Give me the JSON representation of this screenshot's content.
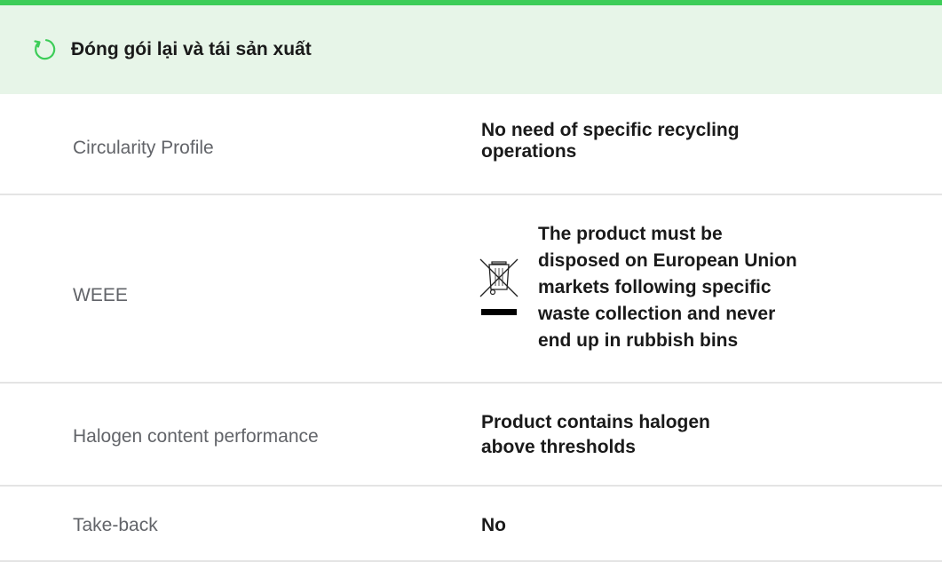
{
  "section": {
    "title": "Đóng gói lại và tái sản xuất",
    "icon": "refresh-cycle-icon",
    "accent_color": "#3dcd58",
    "header_bg": "#e7f5e8"
  },
  "rows": [
    {
      "label": "Circularity Profile",
      "value_line1": "No need of specific recycling",
      "value_line2": "operations"
    },
    {
      "label": "WEEE",
      "icon": "crossed-out-wheelie-bin-icon",
      "value_line1": "The product must be",
      "value_line2": "disposed on European Union",
      "value_line3": "markets following specific",
      "value_line4": "waste collection and never",
      "value_line5": "end up in rubbish bins"
    },
    {
      "label": "Halogen content performance",
      "value_line1": "Product contains halogen",
      "value_line2": "above thresholds"
    },
    {
      "label": "Take-back",
      "value_line1": "No"
    }
  ]
}
